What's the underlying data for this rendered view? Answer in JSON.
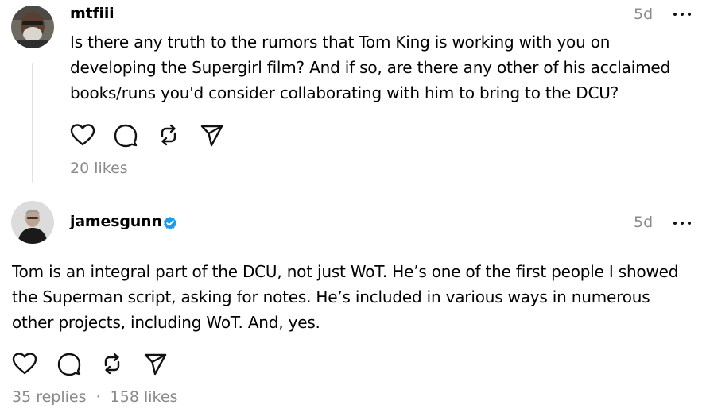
{
  "post": {
    "username": "mtfiii",
    "time": "5d",
    "lines": [
      "Is there any truth to the rumors that Tom King is working with you on",
      "developing the Supergirl film? And if so, are there any other of his acclaimed",
      "books/runs you'd consider collaborating with him to bring to the DCU?"
    ],
    "likes": "20 likes"
  },
  "reply": {
    "username": "jamesgunn",
    "verified": true,
    "time": "5d",
    "lines": [
      "Tom is an integral part of the DCU, not just WoT. He’s one of the first people I showed",
      "the Superman script, asking for notes. He’s included in various ways in numerous",
      "other projects, including WoT. And, yes."
    ],
    "replies": "35 replies",
    "separator": "·",
    "likes": "158 likes"
  },
  "icons": {
    "like": "heart-icon",
    "comment": "comment-icon",
    "repost": "repost-icon",
    "share": "send-icon",
    "more": "more-icon",
    "verified": "verified-badge-icon"
  },
  "colors": {
    "verified": "#1d9bf0",
    "muted": "#8a8a8a",
    "thread_line": "#e2e2e2"
  }
}
